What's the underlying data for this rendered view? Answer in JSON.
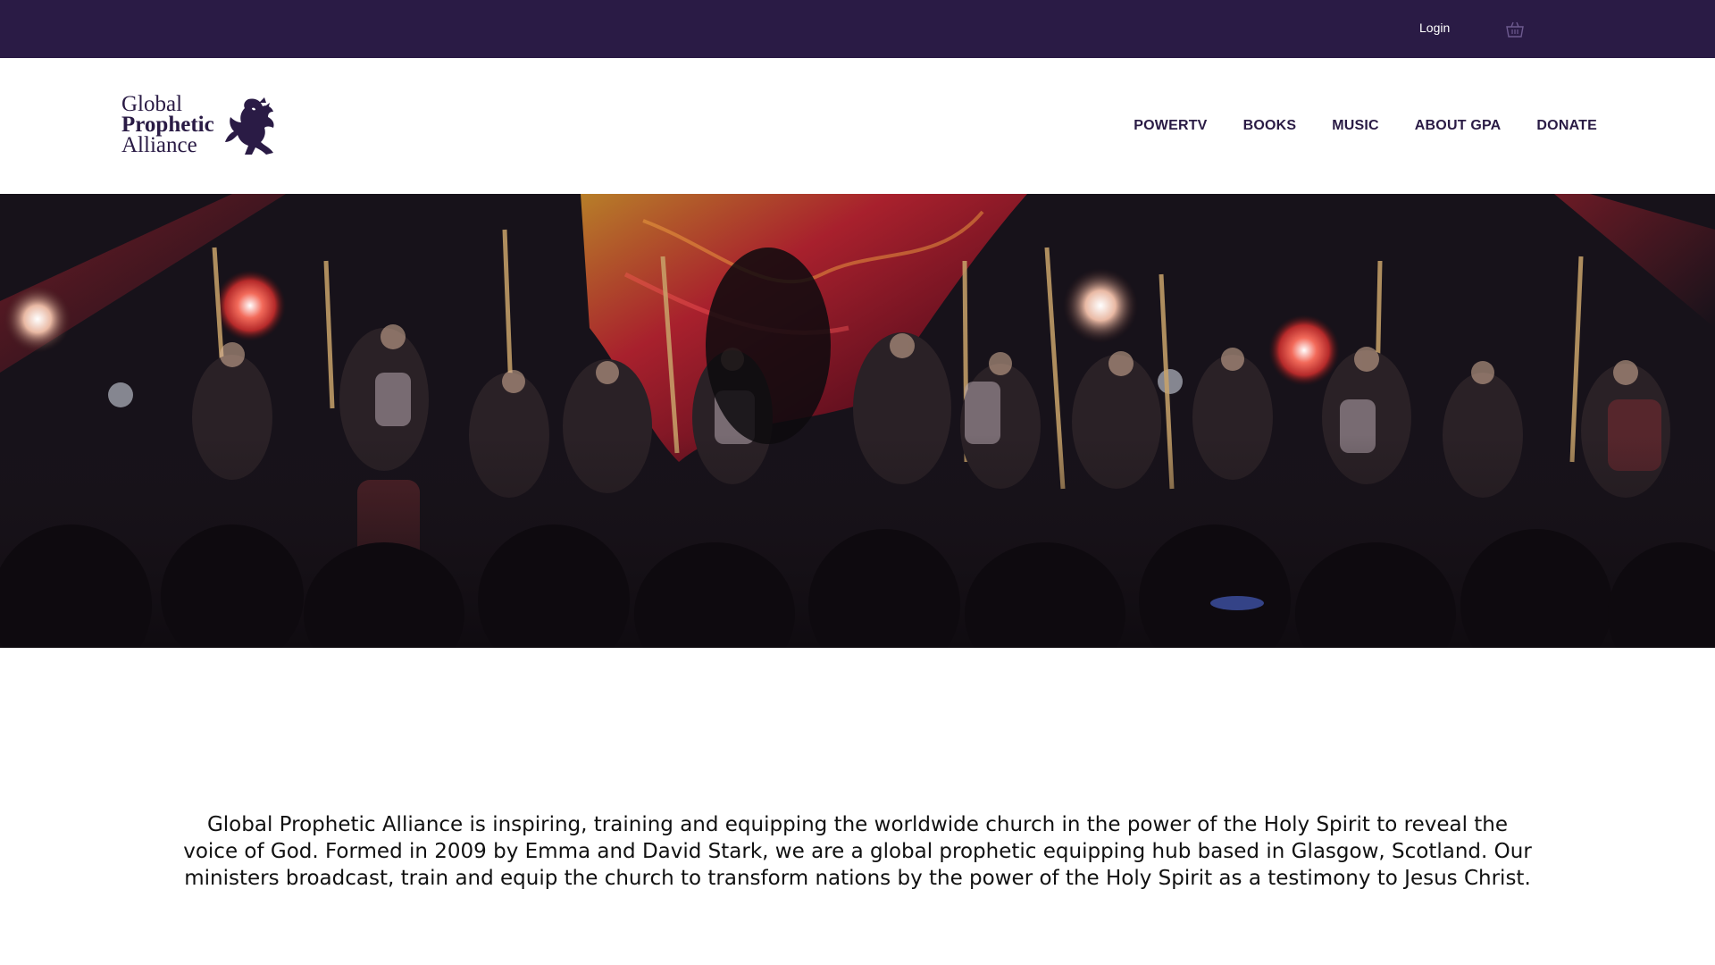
{
  "topbar": {
    "login_label": "Login",
    "cart_icon": "shopping-basket-icon",
    "background": "#2a1b45"
  },
  "header": {
    "logo": {
      "line1": "Global",
      "line2": "Prophetic",
      "line3": "Alliance",
      "emblem_icon": "lion-rampant-icon"
    },
    "nav": [
      {
        "label": "POWERTV"
      },
      {
        "label": "BOOKS"
      },
      {
        "label": "MUSIC"
      },
      {
        "label": "ABOUT GPA"
      },
      {
        "label": "DONATE"
      }
    ]
  },
  "hero": {
    "image_description_icon": "worship-stage-photo"
  },
  "mission": {
    "text": "Global Prophetic Alliance is inspiring, training and equipping the worldwide church in the power of the Holy Spirit to reveal the voice of God. Formed in 2009 by Emma and David Stark, we are a global prophetic equipping hub based in Glasgow, Scotland. Our ministers broadcast, train and equip the church to transform nations by the power of the Holy Spirit as a testimony to Jesus Christ."
  },
  "colors": {
    "brand_purple": "#2a1b45",
    "text_dark": "#111111"
  }
}
